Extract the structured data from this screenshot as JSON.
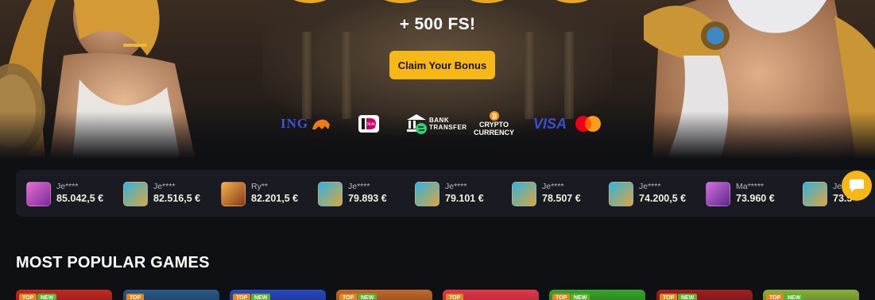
{
  "hero": {
    "bonus_text": "+ 500 FS!",
    "claim_button": "Claim Your Bonus"
  },
  "payments": [
    {
      "label": "ING",
      "icon": "ing-lion-icon"
    },
    {
      "label": "iDEAL",
      "icon": "ideal-icon"
    },
    {
      "label": "BANK\nTRANSFER",
      "label_top": "BANK",
      "label_bottom": "TRANSFER",
      "icon": "bank-icon"
    },
    {
      "label_top": "CRYPTO",
      "label_bottom": "CURRENCY",
      "icon": "bitcoin-icon"
    },
    {
      "label": "VISA",
      "icon": "visa-icon"
    },
    {
      "label": "",
      "icon": "mastercard-icon"
    }
  ],
  "winners": [
    {
      "user": "Je****",
      "amount": "85.042,5 €",
      "thumb_color": "#c04ab8"
    },
    {
      "user": "Je****",
      "amount": "82.516,5 €",
      "thumb_color": "#1e8fbf"
    },
    {
      "user": "Ry**",
      "amount": "82.201,5 €",
      "thumb_color": "#c0702a"
    },
    {
      "user": "Je****",
      "amount": "79.893 €",
      "thumb_color": "#1e8fbf"
    },
    {
      "user": "Je****",
      "amount": "79.101 €",
      "thumb_color": "#1e8fbf"
    },
    {
      "user": "Je****",
      "amount": "78.507 €",
      "thumb_color": "#1e8fbf"
    },
    {
      "user": "Je****",
      "amount": "74.200,5 €",
      "thumb_color": "#1e8fbf"
    },
    {
      "user": "Ma*****",
      "amount": "73.960 €",
      "thumb_color": "#a34fd0"
    },
    {
      "user": "Je",
      "amount": "73.5",
      "thumb_color": "#1e8fbf"
    }
  ],
  "section": {
    "title": "MOST POPULAR GAMES"
  },
  "games": [
    {
      "top": "TOP",
      "new": "NEW",
      "color": "#b3261e"
    },
    {
      "top": "TOP",
      "new": "",
      "color": "#1d3f6e"
    },
    {
      "top": "TOP",
      "new": "NEW",
      "color": "#1d3aa3"
    },
    {
      "top": "TOP",
      "new": "NEW",
      "color": "#a3551a"
    },
    {
      "top": "TOP",
      "new": "",
      "color": "#c22a2a"
    },
    {
      "top": "TOP",
      "new": "NEW",
      "color": "#2f8a22"
    },
    {
      "top": "TOP",
      "new": "NEW",
      "color": "#8a1a1a"
    },
    {
      "top": "TOP",
      "new": "NEW",
      "color": "#6a8a26"
    }
  ],
  "colors": {
    "accent": "#f5b817",
    "background": "#0f1014",
    "ticker_bg": "#1a1b22"
  }
}
